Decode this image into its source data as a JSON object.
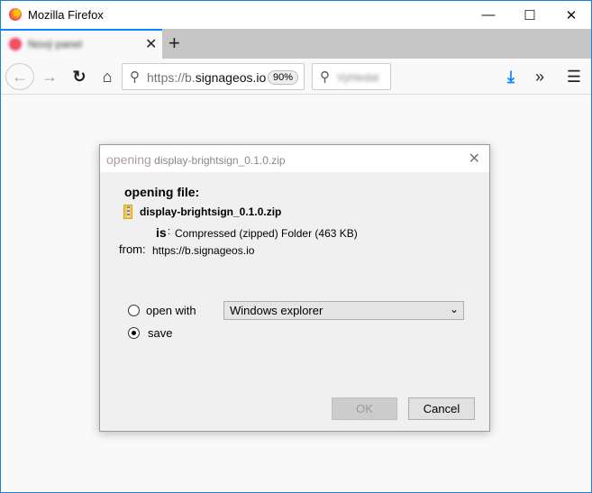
{
  "window": {
    "title": "Mozilla Firefox",
    "accent": "#1883d7"
  },
  "tab": {
    "title": "Nový panel"
  },
  "navbar": {
    "url_prefix": "https://b.",
    "url_domain": "signageos.io",
    "zoom": "90%",
    "search_placeholder": "Vyhledat"
  },
  "dialog": {
    "title_prefix": "opening",
    "title_file": "display-brightsign_0.1.0.zip",
    "heading": "opening file:",
    "filename": "display-brightsign_0.1.0.zip",
    "is_label": "is",
    "type": "Compressed (zipped) Folder (463 KB)",
    "from_label": "from:",
    "from": "https://b.signageos.io",
    "open_with_label": "open with",
    "open_with_app": "Windows explorer",
    "save_label": "save",
    "selected": "save",
    "ok": "OK",
    "cancel": "Cancel"
  }
}
